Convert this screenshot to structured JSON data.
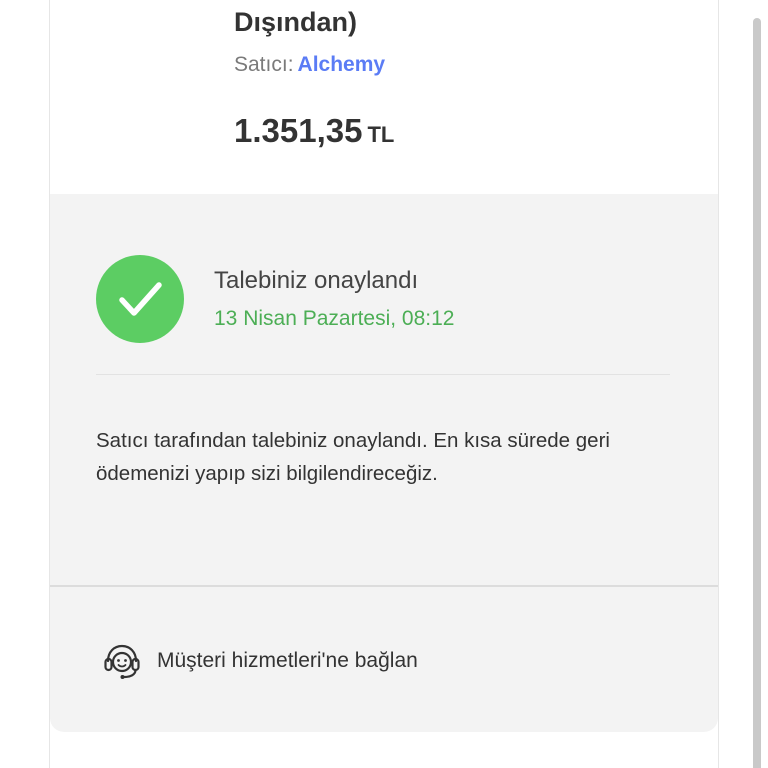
{
  "product": {
    "name_tail": "Dışından)",
    "seller_label": "Satıcı:",
    "seller_name": "Alchemy",
    "price_amount": "1.351,35",
    "price_currency": "TL"
  },
  "status": {
    "icon": "check-icon",
    "title": "Talebiniz onaylandı",
    "date": "13 Nisan Pazartesi, 08:12",
    "message": "Satıcı tarafından talebiniz onaylandı. En kısa sürede geri ödemenizi yapıp sizi bilgilendireceğiz."
  },
  "support": {
    "icon": "headset-icon",
    "label": "Müşteri hizmetleri'ne bağlan"
  },
  "colors": {
    "accent_link": "#5b7cf5",
    "success": "#5ccd63",
    "success_text": "#4cae55",
    "panel_bg": "#f3f3f3"
  }
}
